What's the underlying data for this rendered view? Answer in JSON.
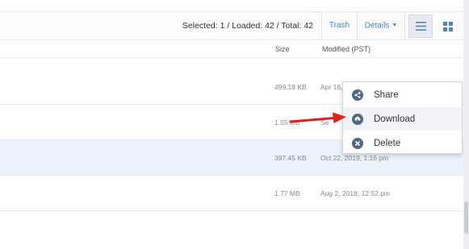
{
  "toolbar": {
    "status": "Selected: 1 / Loaded: 42 / Total: 42",
    "trash_label": "Trash",
    "details_label": "Details",
    "details_caret": "▼"
  },
  "columns": {
    "size": "Size",
    "modified": "Modified (PST)"
  },
  "rows": [
    {
      "size": "499.18 KB",
      "modified": "Apr 16,"
    },
    {
      "size": "1.55 MB",
      "modified": "Se"
    },
    {
      "size": "397.45 KB",
      "modified": "Oct 22, 2019, 1:16 pm"
    },
    {
      "size": "1.77 MB",
      "modified": "Aug 2, 2018, 12:52 pm"
    }
  ],
  "context_menu": {
    "items": [
      {
        "label": "Share",
        "icon": "share-icon"
      },
      {
        "label": "Download",
        "icon": "download-icon"
      },
      {
        "label": "Delete",
        "icon": "delete-icon"
      }
    ]
  },
  "colors": {
    "accent": "#4a86c5",
    "selected_row": "#eaf3fb",
    "menu_icon": "#4d6a85",
    "annotation_arrow": "#e02020"
  }
}
